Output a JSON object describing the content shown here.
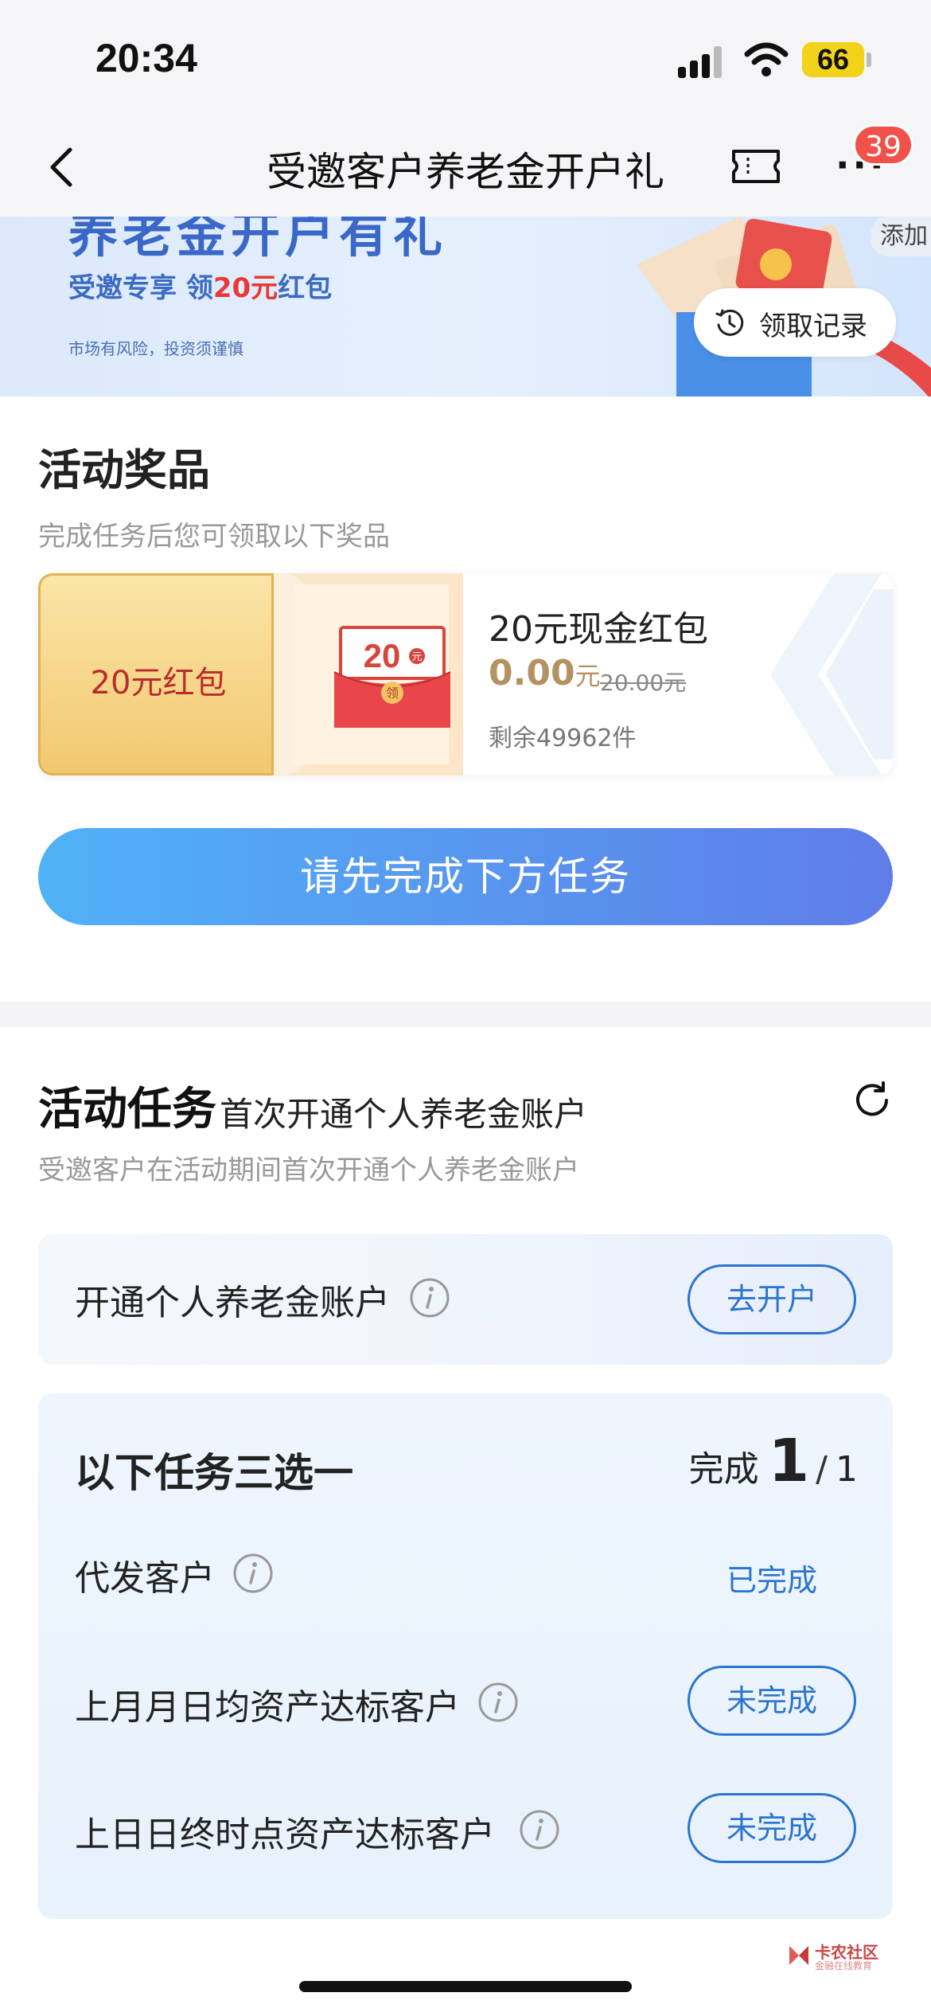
{
  "status_bar": {
    "time": "20:34",
    "battery": "66"
  },
  "nav": {
    "title": "受邀客户养老金开户礼",
    "badge": "39"
  },
  "banner": {
    "title": "养老金开户有礼",
    "sub_prefix": "受邀专享 领",
    "sub_highlight": "20元",
    "sub_suffix": "红包",
    "risk": "市场有风险，投资须谨慎",
    "add_label": "添加",
    "record_label": "领取记录"
  },
  "prize": {
    "section_title": "活动奖品",
    "section_sub": "完成任务后您可领取以下奖品",
    "coupon_label": "20元红包",
    "envelope_value": "20",
    "envelope_unit": "元",
    "envelope_stamp": "领",
    "name": "20元现金红包",
    "price": "0.00",
    "price_unit": "元",
    "original_price": "20.00元",
    "stock": "剩余49962件",
    "cta": "请先完成下方任务"
  },
  "tasks": {
    "title": "活动任务",
    "title_sub": "首次开通个人养老金账户",
    "desc": "受邀客户在活动期间首次开通个人养老金账户",
    "open_account": {
      "label": "开通个人养老金账户",
      "button": "去开户"
    },
    "group": {
      "title": "以下任务三选一",
      "progress_label": "完成",
      "progress_done": "1",
      "progress_sep": "/",
      "progress_total": "1",
      "items": [
        {
          "label": "代发客户",
          "status": "已完成"
        },
        {
          "label": "上月月日均资产达标客户",
          "status": "未完成"
        },
        {
          "label": "上日日终时点资产达标客户",
          "status": "未完成"
        }
      ]
    }
  },
  "watermark": {
    "main": "卡农社区",
    "sub": "金融在线教育"
  },
  "colors": {
    "accent_blue": "#2c74cf",
    "cta_start": "#50b2f7",
    "cta_end": "#5f7de8",
    "badge_red": "#f0514a",
    "price_gold": "#b39262"
  },
  "icons": [
    "back-chevron-icon",
    "ticket-icon",
    "more-icon",
    "clock-icon",
    "refresh-icon",
    "info-icon",
    "signal-icon",
    "wifi-icon"
  ]
}
